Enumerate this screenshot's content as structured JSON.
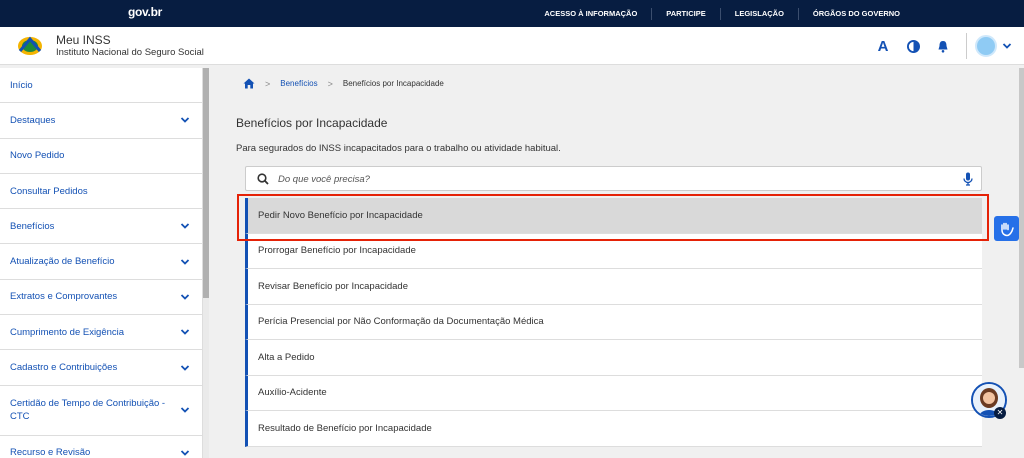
{
  "gov_bar": {
    "logo": "gov.br",
    "links": [
      "ACESSO À INFORMAÇÃO",
      "PARTICIPE",
      "LEGISLAÇÃO",
      "ÓRGÃOS DO GOVERNO"
    ]
  },
  "header": {
    "title": "Meu INSS",
    "subtitle": "Instituto Nacional do Seguro Social",
    "font_size_label": "A"
  },
  "sidebar": {
    "items": [
      {
        "label": "Início",
        "has_submenu": false
      },
      {
        "label": "Destaques",
        "has_submenu": true
      },
      {
        "label": "Novo Pedido",
        "has_submenu": false
      },
      {
        "label": "Consultar Pedidos",
        "has_submenu": false
      },
      {
        "label": "Benefícios",
        "has_submenu": true
      },
      {
        "label": "Atualização de Benefício",
        "has_submenu": true
      },
      {
        "label": "Extratos e Comprovantes",
        "has_submenu": true
      },
      {
        "label": "Cumprimento de Exigência",
        "has_submenu": true
      },
      {
        "label": "Cadastro e Contribuições",
        "has_submenu": true
      },
      {
        "label": "Certidão de Tempo de Contribuição - CTC",
        "has_submenu": true
      },
      {
        "label": "Recurso e Revisão",
        "has_submenu": true
      }
    ]
  },
  "breadcrumb": {
    "home_icon": "home-icon",
    "items": [
      "Benefícios",
      "Benefícios por Incapacidade"
    ]
  },
  "main": {
    "title": "Benefícios por Incapacidade",
    "description": "Para segurados do INSS incapacitados para o trabalho ou atividade habitual.",
    "search_placeholder": "Do que você precisa?",
    "services": [
      "Pedir Novo Benefício por Incapacidade",
      "Prorrogar Benefício por Incapacidade",
      "Revisar Benefício por Incapacidade",
      "Perícia Presencial por Não Conformação da Documentação Médica",
      "Alta a Pedido",
      "Auxílio-Acidente",
      "Resultado de Benefício por Incapacidade"
    ]
  },
  "colors": {
    "gov_blue": "#071d41",
    "link_blue": "#1351b4",
    "highlight_red": "#e52207"
  }
}
